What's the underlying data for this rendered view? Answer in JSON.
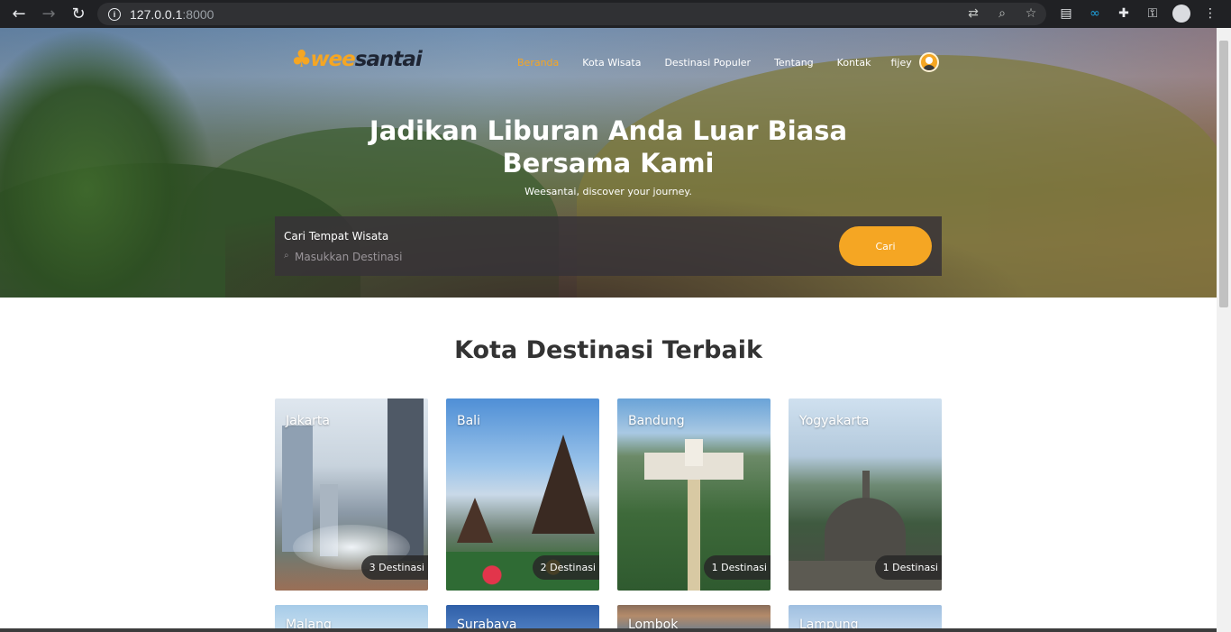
{
  "browser": {
    "url_host": "127.0.0.1",
    "url_port": ":8000",
    "back_icon": "arrow-left-icon",
    "forward_icon": "arrow-right-icon",
    "reload_icon": "reload-icon",
    "omnibox_icons": [
      "translate-icon",
      "zoom-icon",
      "star-icon"
    ],
    "extensions": [
      "document-icon",
      "infinity-icon",
      "puzzle-icon",
      "key-icon",
      "profile-icon",
      "menu-icon"
    ]
  },
  "header": {
    "brand_part1": "wee",
    "brand_part2": "santai",
    "menu": [
      {
        "label": "Beranda",
        "active": true
      },
      {
        "label": "Kota Wisata",
        "active": false
      },
      {
        "label": "Destinasi Populer",
        "active": false
      },
      {
        "label": "Tentang",
        "active": false
      },
      {
        "label": "Kontak",
        "active": false
      }
    ],
    "username": "fijey"
  },
  "hero": {
    "title_line1": "Jadikan Liburan Anda Luar Biasa",
    "title_line2": "Bersama Kami",
    "subtitle": "Weesantai, discover your journey.",
    "search_label": "Cari Tempat Wisata",
    "search_placeholder": "Masukkan Destinasi",
    "search_button": "Cari"
  },
  "section": {
    "title": "Kota Destinasi Terbaik",
    "cards": [
      {
        "name": "Jakarta",
        "count": "3 Destinasi"
      },
      {
        "name": "Bali",
        "count": "2 Destinasi"
      },
      {
        "name": "Bandung",
        "count": "1 Destinasi"
      },
      {
        "name": "Yogyakarta",
        "count": "1 Destinasi"
      },
      {
        "name": "Malang"
      },
      {
        "name": "Surabaya"
      },
      {
        "name": "Lombok"
      },
      {
        "name": "Lampung"
      }
    ]
  },
  "colors": {
    "accent": "#f5a623",
    "dark": "#1e2533",
    "chrome": "#202124"
  }
}
